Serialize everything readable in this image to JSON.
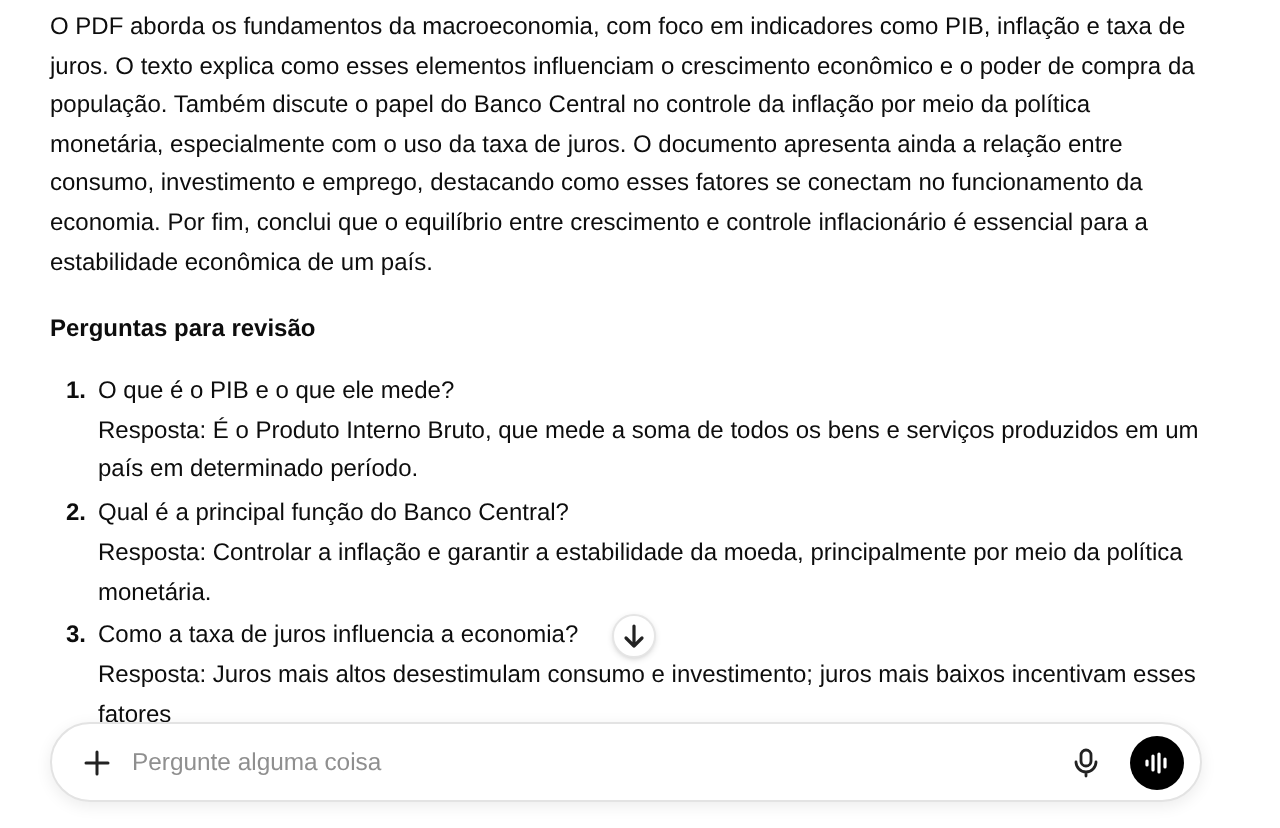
{
  "summary": "O PDF aborda os fundamentos da macroeconomia, com foco em indicadores como PIB, inflação e taxa de juros. O texto explica como esses elementos influenciam o crescimento econômico e o poder de compra da população. Também discute o papel do Banco Central no controle da inflação por meio da política monetária, especialmente com o uso da taxa de juros. O documento apresenta ainda a relação entre consumo, investimento e emprego, destacando como esses fatores se conectam no funcionamento da economia. Por fim, conclui que o equilíbrio entre crescimento e controle inflacionário é essencial para a estabilidade econômica de um país.",
  "section_heading": "Perguntas para revisão",
  "questions": [
    {
      "number": "1.",
      "question": "O que é o PIB e o que ele mede?",
      "answer": "Resposta: É o Produto Interno Bruto, que mede a soma de todos os bens e serviços produzidos em um país em determinado período."
    },
    {
      "number": "2.",
      "question": "Qual é a principal função do Banco Central?",
      "answer": "Resposta: Controlar a inflação e garantir a estabilidade da moeda, principalmente por meio da política monetária."
    },
    {
      "number": "3.",
      "question": "Como a taxa de juros influencia a economia?",
      "answer": "Resposta: Juros mais altos desestimulam consumo e investimento; juros mais baixos incentivam esses fatores"
    }
  ],
  "composer": {
    "placeholder": "Pergunte alguma coisa"
  }
}
